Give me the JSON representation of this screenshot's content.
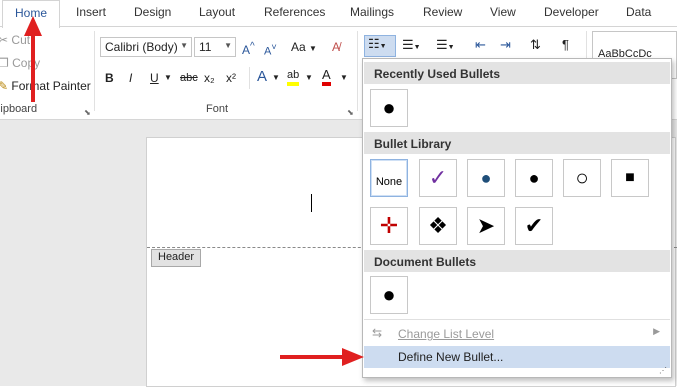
{
  "tabs": [
    "Home",
    "Insert",
    "Design",
    "Layout",
    "References",
    "Mailings",
    "Review",
    "View",
    "Developer",
    "Data"
  ],
  "clipboard": {
    "cut": "Cut",
    "copy": "Copy",
    "format_painter": "Format Painter",
    "group_label": "Clipboard"
  },
  "font": {
    "name": "Calibri (Body)",
    "size": "11",
    "change_case": "Aa",
    "bold": "B",
    "italic": "I",
    "underline": "U",
    "strike": "abc",
    "subscript": "x₂",
    "superscript": "x²",
    "text_effects": "A",
    "highlight": "ab",
    "font_color": "A",
    "grow": "A",
    "shrink": "A",
    "group_label": "Font"
  },
  "styles": {
    "normal_preview": "AaBbCcDc"
  },
  "menu": {
    "recent_header": "Recently Used Bullets",
    "library_header": "Bullet Library",
    "document_header": "Document Bullets",
    "none_label": "None",
    "change_level": "Change List Level",
    "define_new": "Define New Bullet..."
  },
  "document": {
    "header_tag": "Header"
  },
  "colors": {
    "accent": "#2b579a",
    "annotation_red": "#e02020",
    "highlight_blue": "#cddcf0"
  }
}
